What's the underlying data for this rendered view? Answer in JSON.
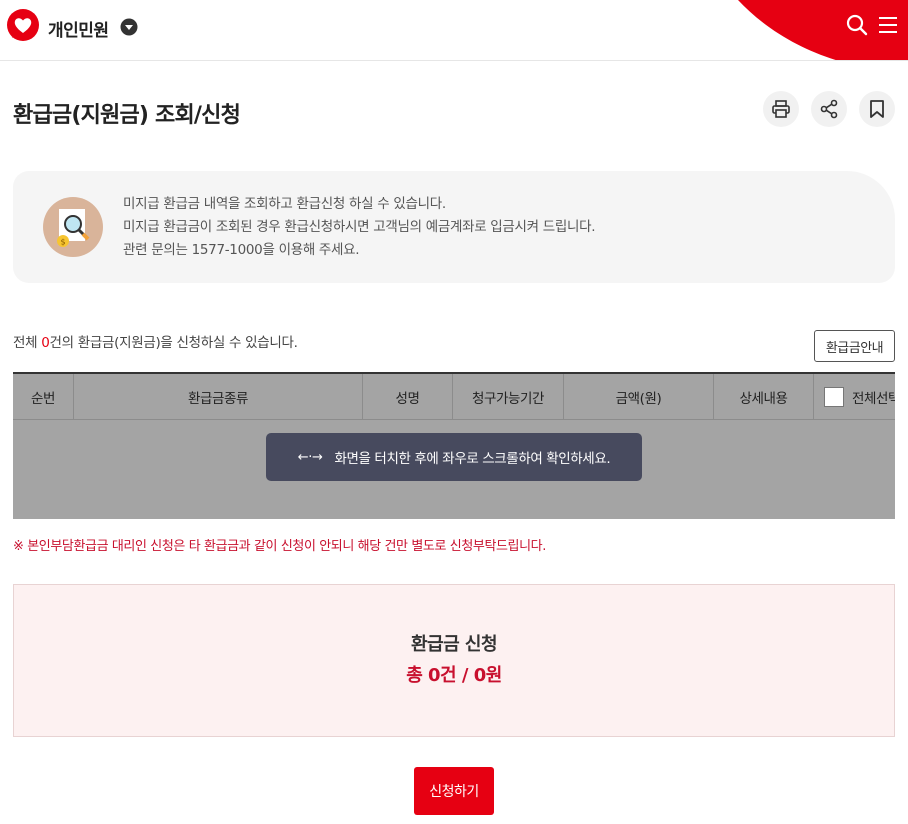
{
  "header": {
    "brand": "개인민원",
    "icons": [
      "heart-logo-icon",
      "caret-down-icon",
      "search-icon",
      "menu-icon"
    ],
    "accent_color": "#e60012"
  },
  "page": {
    "title": "환급금(지원금) 조회/신청",
    "actions": [
      "print-icon",
      "share-icon",
      "bookmark-icon"
    ]
  },
  "info": {
    "lines": [
      "미지급 환급금 내역을 조회하고 환급신청 하실 수 있습니다.",
      "미지급 환급금이 조회된 경우 환급신청하시면 고객님의 예금계좌로 입금시켜 드립니다.",
      "관련 문의는 1577-1000을 이용해 주세요."
    ]
  },
  "summary": {
    "prefix": "전체 ",
    "count": "0",
    "suffix": "건의 환급금(지원금)을 신청하실 수 있습니다.",
    "guide_button": "환급금안내"
  },
  "table": {
    "columns": [
      "순번",
      "환급금종류",
      "성명",
      "청구가능기간",
      "금액(원)",
      "상세내용",
      "전체선택"
    ],
    "scroll_hint_arrow": "←·→",
    "scroll_hint": "화면을 터치한 후에 좌우로 스크롤하여 확인하세요."
  },
  "notice": "※ 본인부담환급금 대리인 신청은 타 환급금과 같이 신청이 안되니 해당 건만 별도로 신청부탁드립니다.",
  "apply": {
    "title": "환급금 신청",
    "total": "총 0건 / 0원",
    "button": "신청하기"
  }
}
